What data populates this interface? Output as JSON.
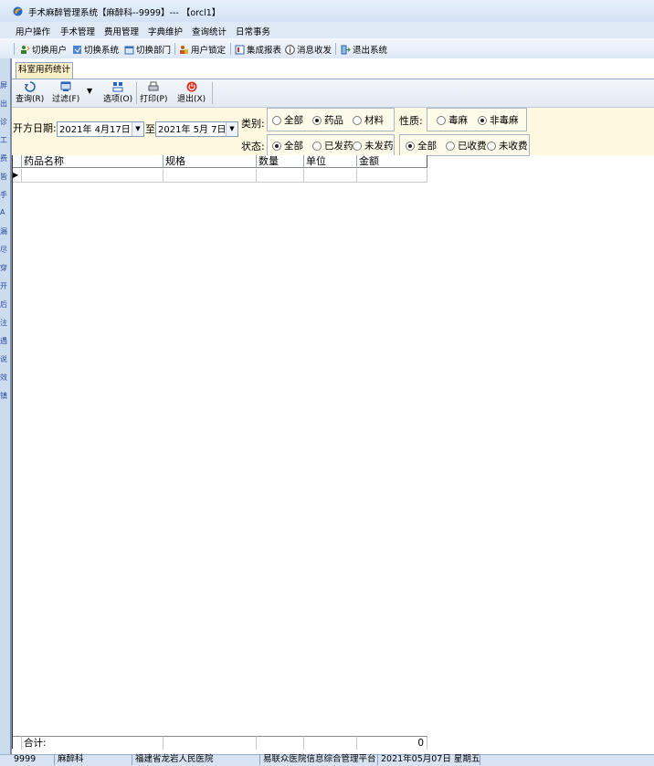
{
  "window": {
    "title": "手术麻醉管理系统【麻醉科--9999】--- 【orcl1】",
    "logo_icon": "app-logo-icon"
  },
  "menu": [
    "用户操作",
    "手术管理",
    "费用管理",
    "字典维护",
    "查询统计",
    "日常事务"
  ],
  "toolbar": [
    {
      "label": "切换用户",
      "icon": "switch-user-icon"
    },
    {
      "label": "切换系统",
      "icon": "switch-system-icon"
    },
    {
      "label": "切换部门",
      "icon": "switch-dept-icon"
    },
    {
      "label": "用户锁定",
      "icon": "lock-user-icon"
    },
    {
      "label": "集成报表",
      "icon": "report-icon"
    },
    {
      "label": "消息收发",
      "icon": "info-icon"
    },
    {
      "label": "退出系统",
      "icon": "exit-icon"
    }
  ],
  "left_strip_chars": [
    "屏",
    "出",
    "诊",
    "工",
    "费",
    "皆",
    "手",
    "A",
    "漏",
    "尽",
    "穿",
    "开",
    "后",
    "注",
    "遇",
    "说",
    "效",
    "镇"
  ],
  "tab": {
    "label": "科室用药统计"
  },
  "commands": [
    {
      "label": "查询(R)",
      "icon": "refresh-icon"
    },
    {
      "label": "过滤(F)",
      "icon": "filter-icon"
    },
    {
      "label": "选项(O)",
      "icon": "options-icon"
    },
    {
      "label": "打印(P)",
      "icon": "print-icon"
    },
    {
      "label": "退出(X)",
      "icon": "power-icon"
    }
  ],
  "filter": {
    "date_label": "开方日期:",
    "date_from": "2021年  4月17日",
    "to_label": "至",
    "date_to": "2021年  5月  7日",
    "category_label": "类别:",
    "category_options": [
      {
        "label": "全部",
        "selected": false
      },
      {
        "label": "药品",
        "selected": true
      },
      {
        "label": "材料",
        "selected": false
      }
    ],
    "nature_label": "性质:",
    "nature_options": [
      {
        "label": "毒麻",
        "selected": false
      },
      {
        "label": "非毒麻",
        "selected": true
      }
    ],
    "status_label": "状态:",
    "status_options": [
      {
        "label": "全部",
        "selected": true
      },
      {
        "label": "已发药",
        "selected": false
      },
      {
        "label": "未发药",
        "selected": false
      }
    ],
    "charge_options": [
      {
        "label": "全部",
        "selected": true
      },
      {
        "label": "已收费",
        "selected": false
      },
      {
        "label": "未收费",
        "selected": false
      }
    ]
  },
  "grid": {
    "columns": [
      "药品名称",
      "规格",
      "数量",
      "单位",
      "金额"
    ],
    "footer_label": "合计:",
    "footer_total": "0"
  },
  "status_bar": [
    "9999",
    "麻醉科",
    "福建省龙岩人民医院",
    "易联众医院信息综合管理平台",
    "2021年05月07日  星期五"
  ]
}
